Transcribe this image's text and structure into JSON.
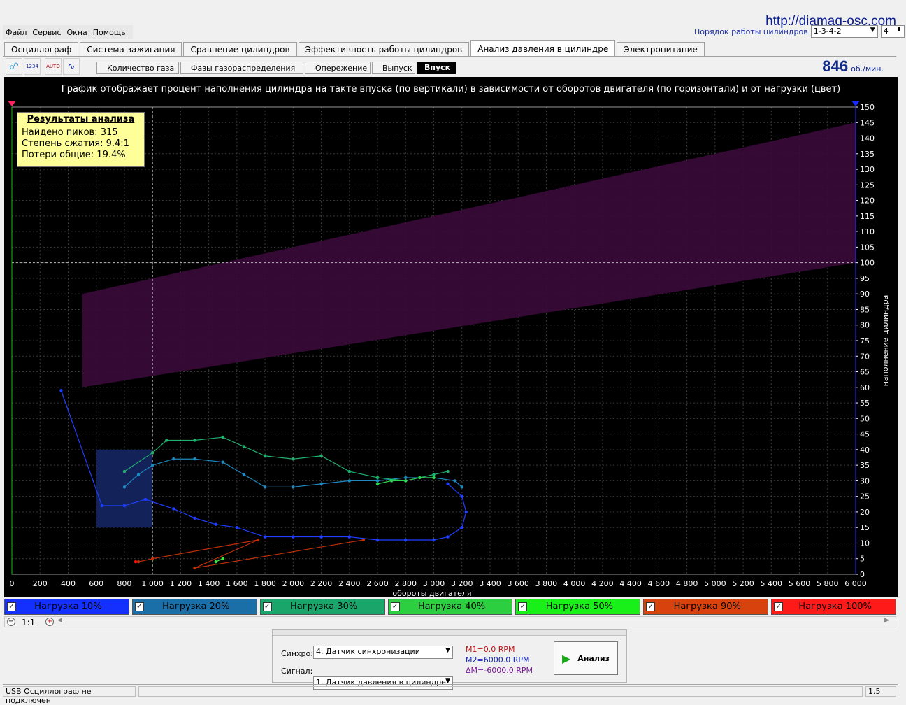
{
  "url_label": "http://diamag-osc.com",
  "menu": [
    "Файл",
    "Сервис",
    "Окна",
    "Помощь"
  ],
  "cylinder_order": {
    "label": "Порядок работы цилиндров",
    "value": "1-3-4-2",
    "count": "4"
  },
  "tabs": [
    {
      "label": "Осциллограф",
      "active": false
    },
    {
      "label": "Система зажигания",
      "active": false
    },
    {
      "label": "Сравнение цилиндров",
      "active": false
    },
    {
      "label": "Эффективность работы цилиндров",
      "active": false
    },
    {
      "label": "Анализ давления в цилиндре",
      "active": true
    },
    {
      "label": "Электропитание",
      "active": false
    }
  ],
  "toolbar_icons": [
    {
      "name": "network-icon",
      "glyph": "☍"
    },
    {
      "name": "cylinder-1234-icon",
      "glyph": "1234"
    },
    {
      "name": "auto-scale-icon",
      "glyph": "AUTO"
    },
    {
      "name": "waveform-icon",
      "glyph": "∿"
    }
  ],
  "subtabs": [
    {
      "label": "Количество газа",
      "active": false
    },
    {
      "label": "Фазы газораспределения",
      "active": false
    },
    {
      "label": "Опережение",
      "active": false
    },
    {
      "label": "Выпуск",
      "active": false
    },
    {
      "label": "Впуск",
      "active": true
    }
  ],
  "rpm": {
    "value": "846",
    "unit": "об./мин."
  },
  "results": {
    "title": "Результаты анализа",
    "lines": [
      "Найдено пиков: 315",
      "Степень сжатия: 9.4:1",
      "Потери общие: 19.4%"
    ]
  },
  "chart_data": {
    "type": "scatter",
    "title": "График отображает процент наполнения цилиндра на такте впуска (по вертикали) в зависимости от оборотов двигателя (по горизонтали) и от нагрузки (цвет)",
    "xlabel": "обороты двигателя",
    "ylabel": "наполнение цилиндра",
    "xlim": [
      0,
      6000
    ],
    "ylim": [
      0,
      150
    ],
    "x_ticks": [
      "0",
      "200",
      "400",
      "600",
      "800",
      "1 000",
      "1 200",
      "1 400",
      "1 600",
      "1 800",
      "2 000",
      "2 200",
      "2 400",
      "2 600",
      "2 800",
      "3 000",
      "3 200",
      "3 400",
      "3 600",
      "3 800",
      "4 000",
      "4 200",
      "4 400",
      "4 600",
      "4 800",
      "5 000",
      "5 200",
      "5 400",
      "5 600",
      "5 800",
      "6 000"
    ],
    "y_ticks": [
      "0",
      "5",
      "10",
      "15",
      "20",
      "25",
      "30",
      "35",
      "40",
      "45",
      "50",
      "55",
      "60",
      "65",
      "70",
      "75",
      "80",
      "85",
      "90",
      "95",
      "100",
      "105",
      "110",
      "115",
      "120",
      "125",
      "130",
      "135",
      "140",
      "145",
      "150"
    ],
    "grid": true,
    "reference_line_y": 100,
    "reference_line_x": 1000,
    "band": {
      "x_start": 500,
      "x_end": 6000,
      "lower": [
        60,
        100
      ],
      "upper": [
        90,
        145
      ],
      "color": "#3a0a3a"
    },
    "idle_box": {
      "x": [
        600,
        1000
      ],
      "y": [
        15,
        40
      ],
      "color": "#14225a"
    },
    "series": [
      {
        "name": "Нагрузка 10%",
        "color": "#1f3fff",
        "points": [
          [
            350,
            59
          ],
          [
            640,
            22
          ],
          [
            800,
            22
          ],
          [
            950,
            24
          ],
          [
            1150,
            21
          ],
          [
            1300,
            18
          ],
          [
            1450,
            16
          ],
          [
            1600,
            15
          ],
          [
            1800,
            12
          ],
          [
            2000,
            12
          ],
          [
            2200,
            12
          ],
          [
            2400,
            12
          ],
          [
            2600,
            11
          ],
          [
            2800,
            11
          ],
          [
            3000,
            11
          ],
          [
            3100,
            12
          ],
          [
            3200,
            15
          ],
          [
            3230,
            20
          ],
          [
            3200,
            25
          ],
          [
            3100,
            29
          ]
        ]
      },
      {
        "name": "Нагрузка 20%",
        "color": "#1e8ac0",
        "points": [
          [
            800,
            28
          ],
          [
            900,
            32
          ],
          [
            1000,
            35
          ],
          [
            1150,
            37
          ],
          [
            1300,
            37
          ],
          [
            1500,
            36
          ],
          [
            1650,
            32
          ],
          [
            1800,
            28
          ],
          [
            2000,
            28
          ],
          [
            2200,
            29
          ],
          [
            2400,
            30
          ],
          [
            2600,
            30
          ],
          [
            2800,
            31
          ],
          [
            3000,
            31
          ],
          [
            3150,
            30
          ],
          [
            3200,
            28
          ]
        ]
      },
      {
        "name": "Нагрузка 30%",
        "color": "#22b070",
        "points": [
          [
            800,
            33
          ],
          [
            1000,
            39
          ],
          [
            1100,
            43
          ],
          [
            1300,
            43
          ],
          [
            1500,
            44
          ],
          [
            1650,
            41
          ],
          [
            1800,
            38
          ],
          [
            2000,
            37
          ],
          [
            2200,
            38
          ],
          [
            2400,
            33
          ],
          [
            2600,
            31
          ],
          [
            2800,
            30
          ],
          [
            3000,
            32
          ],
          [
            3100,
            33
          ]
        ]
      },
      {
        "name": "Нагрузка 40%",
        "color": "#30d050",
        "points": [
          [
            2600,
            29
          ],
          [
            2700,
            30
          ],
          [
            2800,
            30
          ],
          [
            2900,
            31
          ],
          [
            3000,
            31
          ]
        ]
      },
      {
        "name": "Нагрузка 50%",
        "color": "#3fe83f",
        "points": [
          [
            1450,
            4
          ],
          [
            1500,
            5
          ]
        ]
      },
      {
        "name": "Нагрузка 90%",
        "color": "#c0300a",
        "points": [
          [
            900,
            4
          ],
          [
            1000,
            5
          ],
          [
            1750,
            11
          ],
          [
            1300,
            2
          ],
          [
            2500,
            11
          ]
        ]
      },
      {
        "name": "Нагрузка 100%",
        "color": "#ff1010",
        "points": [
          [
            880,
            4
          ]
        ]
      }
    ]
  },
  "legend": [
    {
      "label": "Нагрузка 10%",
      "color": "#1430ff"
    },
    {
      "label": "Нагрузка 20%",
      "color": "#1b6fa8"
    },
    {
      "label": "Нагрузка 30%",
      "color": "#1aa56a"
    },
    {
      "label": "Нагрузка 40%",
      "color": "#2bcf3f"
    },
    {
      "label": "Нагрузка 50%",
      "color": "#19f019"
    },
    {
      "label": "Нагрузка 90%",
      "color": "#d8420c"
    },
    {
      "label": "Нагрузка 100%",
      "color": "#ff1a1a"
    }
  ],
  "zoom": {
    "label": "1:1"
  },
  "controls": {
    "sync_label": "Синхро:",
    "sync_value": "4.  Датчик синхронизации",
    "signal_label": "Сигнал:",
    "signal_value": "1.  Датчик давления в цилиндре",
    "m1": "M1=0.0 RPM",
    "m2": "M2=6000.0 RPM",
    "dm": "ΔM=-6000.0 RPM",
    "analyze_label": "Анализ"
  },
  "status": {
    "connection": "USB Осциллограф не подключен",
    "version": "1.5"
  }
}
